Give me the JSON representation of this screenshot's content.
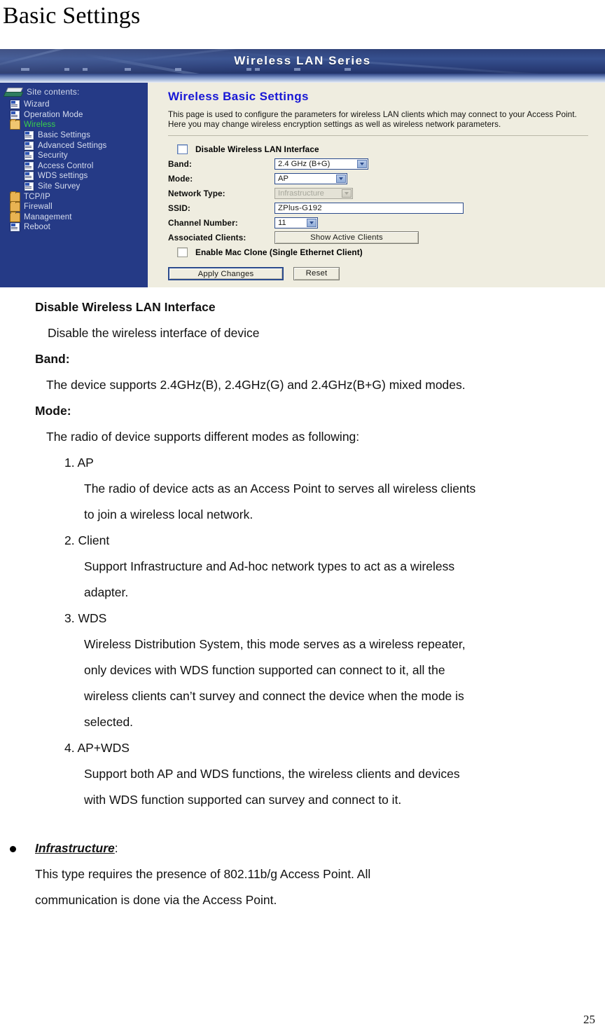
{
  "document": {
    "heading": "Basic Settings",
    "page_number": "25"
  },
  "router_ui": {
    "banner_title": "Wireless LAN Series",
    "sidebar": {
      "header": "Site contents:",
      "items": [
        {
          "label": "Wizard",
          "icon": "page-icon",
          "level": 1,
          "active": false
        },
        {
          "label": "Operation Mode",
          "icon": "page-icon",
          "level": 1,
          "active": false
        },
        {
          "label": "Wireless",
          "icon": "folder-open-icon",
          "level": 1,
          "active": true
        },
        {
          "label": "Basic Settings",
          "icon": "page-icon",
          "level": 2,
          "active": false
        },
        {
          "label": "Advanced Settings",
          "icon": "page-icon",
          "level": 2,
          "active": false
        },
        {
          "label": "Security",
          "icon": "page-icon",
          "level": 2,
          "active": false
        },
        {
          "label": "Access Control",
          "icon": "page-icon",
          "level": 2,
          "active": false
        },
        {
          "label": "WDS settings",
          "icon": "page-icon",
          "level": 2,
          "active": false
        },
        {
          "label": "Site Survey",
          "icon": "page-icon",
          "level": 2,
          "active": false
        },
        {
          "label": "TCP/IP",
          "icon": "folder-icon",
          "level": 1,
          "active": false
        },
        {
          "label": "Firewall",
          "icon": "folder-icon",
          "level": 1,
          "active": false
        },
        {
          "label": "Management",
          "icon": "folder-icon",
          "level": 1,
          "active": false
        },
        {
          "label": "Reboot",
          "icon": "page-icon",
          "level": 1,
          "active": false
        }
      ]
    },
    "content": {
      "title": "Wireless Basic Settings",
      "description": "This page is used to configure the parameters for wireless LAN clients which may connect to your Access Point. Here you may change wireless encryption settings as well as wireless network parameters.",
      "disable_checkbox_label": "Disable Wireless LAN Interface",
      "labels": {
        "band": "Band:",
        "mode": "Mode:",
        "network_type": "Network Type:",
        "ssid": "SSID:",
        "channel_number": "Channel Number:",
        "associated_clients": "Associated Clients:"
      },
      "values": {
        "band": "2.4 GHz (B+G)",
        "mode": "AP",
        "network_type": "Infrastructure",
        "ssid": "ZPlus-G192",
        "channel_number": "11"
      },
      "show_active_clients_label": "Show Active Clients",
      "mac_clone_label": "Enable Mac Clone (Single Ethernet Client)",
      "apply_label": "Apply Changes",
      "reset_label": "Reset",
      "colors": {
        "banner_blue": "#2c3f77",
        "sidebar_blue": "#253a86",
        "panel_beige": "#efede0",
        "title_blue": "#1717d6",
        "active_green": "#39d14a"
      }
    }
  },
  "body": {
    "sections": [
      {
        "type": "heading",
        "text": "Disable Wireless LAN Interface"
      },
      {
        "type": "para",
        "text": "Disable the wireless interface of device"
      },
      {
        "type": "heading",
        "text": "Band:"
      },
      {
        "type": "para",
        "text": "The device supports 2.4GHz(B), 2.4GHz(G) and 2.4GHz(B+G) mixed modes."
      },
      {
        "type": "heading",
        "text": "Mode:"
      },
      {
        "type": "para",
        "text": "The radio of device supports different modes as following:"
      },
      {
        "type": "num",
        "text": "1. AP"
      },
      {
        "type": "sub",
        "text": "The radio of device acts as an Access Point to serves all wireless clients"
      },
      {
        "type": "sub",
        "text": "to join a wireless local network."
      },
      {
        "type": "num",
        "text": "2. Client"
      },
      {
        "type": "sub",
        "text": "Support Infrastructure and Ad-hoc network types to act as a wireless"
      },
      {
        "type": "sub",
        "text": "adapter."
      },
      {
        "type": "num",
        "text": "3. WDS"
      },
      {
        "type": "sub",
        "text": "Wireless Distribution System, this mode serves as a wireless repeater,"
      },
      {
        "type": "sub",
        "text": "only devices with WDS function supported can connect to it, all the"
      },
      {
        "type": "sub",
        "text": "wireless clients can’t survey and connect the device when the mode is"
      },
      {
        "type": "sub",
        "text": "selected."
      },
      {
        "type": "num",
        "text": "4. AP+WDS"
      },
      {
        "type": "sub",
        "text": "Support both AP and WDS functions, the wireless clients and devices"
      },
      {
        "type": "sub",
        "text": "with WDS function supported can survey and connect to it."
      }
    ],
    "bullet": {
      "term": "Infrastructure",
      "term_suffix": ":",
      "lines": [
        "This type requires the presence of 802.11b/g Access Point. All",
        "communication is done via the Access Point."
      ]
    }
  }
}
